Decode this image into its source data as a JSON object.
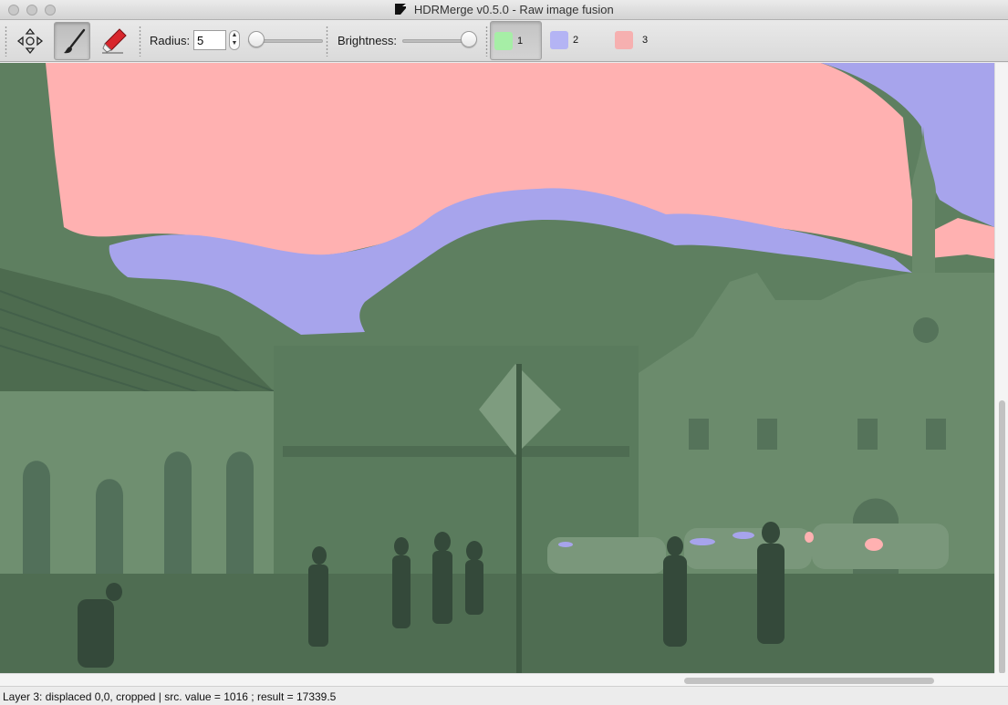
{
  "window": {
    "title": "HDRMerge v0.5.0 - Raw image fusion"
  },
  "toolbar": {
    "tools": [
      {
        "name": "move-tool",
        "icon": "move-arrows-icon",
        "active": false
      },
      {
        "name": "brush-tool",
        "icon": "paintbrush-icon",
        "active": true
      },
      {
        "name": "eraser-tool",
        "icon": "eraser-pencil-icon",
        "active": false
      }
    ],
    "radius_label": "Radius:",
    "radius_value": "5",
    "radius_slider_fraction": 0.0,
    "brightness_label": "Brightness:",
    "brightness_slider_fraction": 1.0,
    "layers": [
      {
        "label": "1",
        "color": "#a6eea6",
        "active": true
      },
      {
        "label": "2",
        "color": "#b4b4f4",
        "active": false
      },
      {
        "label": "3",
        "color": "#f6b0b0",
        "active": false
      }
    ]
  },
  "overlay_colors": {
    "layer1": "#5e7f60",
    "layer2": "#a7a4ec",
    "layer3": "#ffb1b1"
  },
  "status": {
    "text": "Layer 3: displaced 0,0, cropped | src. value = 1016 ; result = 17339.5"
  }
}
